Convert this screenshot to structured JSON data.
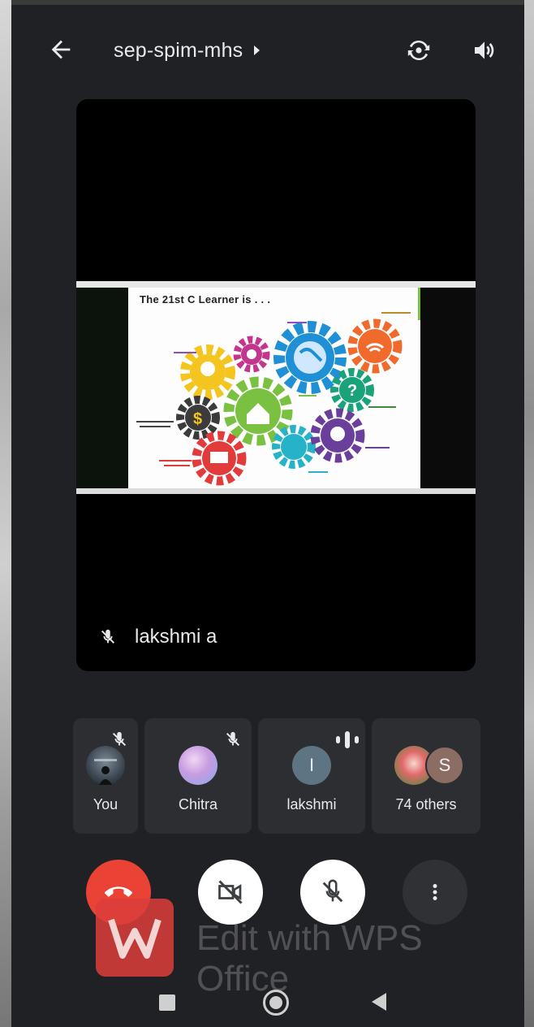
{
  "meeting": {
    "title": "sep-spim-mhs"
  },
  "main_tile": {
    "presenter_name": "lakshmi a",
    "slide_title": "The 21st C Learner is . . ."
  },
  "participants": [
    {
      "name": "You",
      "muted": true
    },
    {
      "name": "Chitra",
      "muted": true
    },
    {
      "name": "lakshmi",
      "initial": "I",
      "speaking": true
    },
    {
      "name": "74 others",
      "initial": "S"
    }
  ],
  "controls": {
    "end_call": "end-call",
    "camera": "camera-off",
    "microphone": "mic-off",
    "more": "more-options"
  },
  "watermark": {
    "text": "Edit with WPS Office"
  },
  "colors": {
    "end_call": "#ea4335",
    "surface": "#202124",
    "tile": "#2d2e31"
  }
}
